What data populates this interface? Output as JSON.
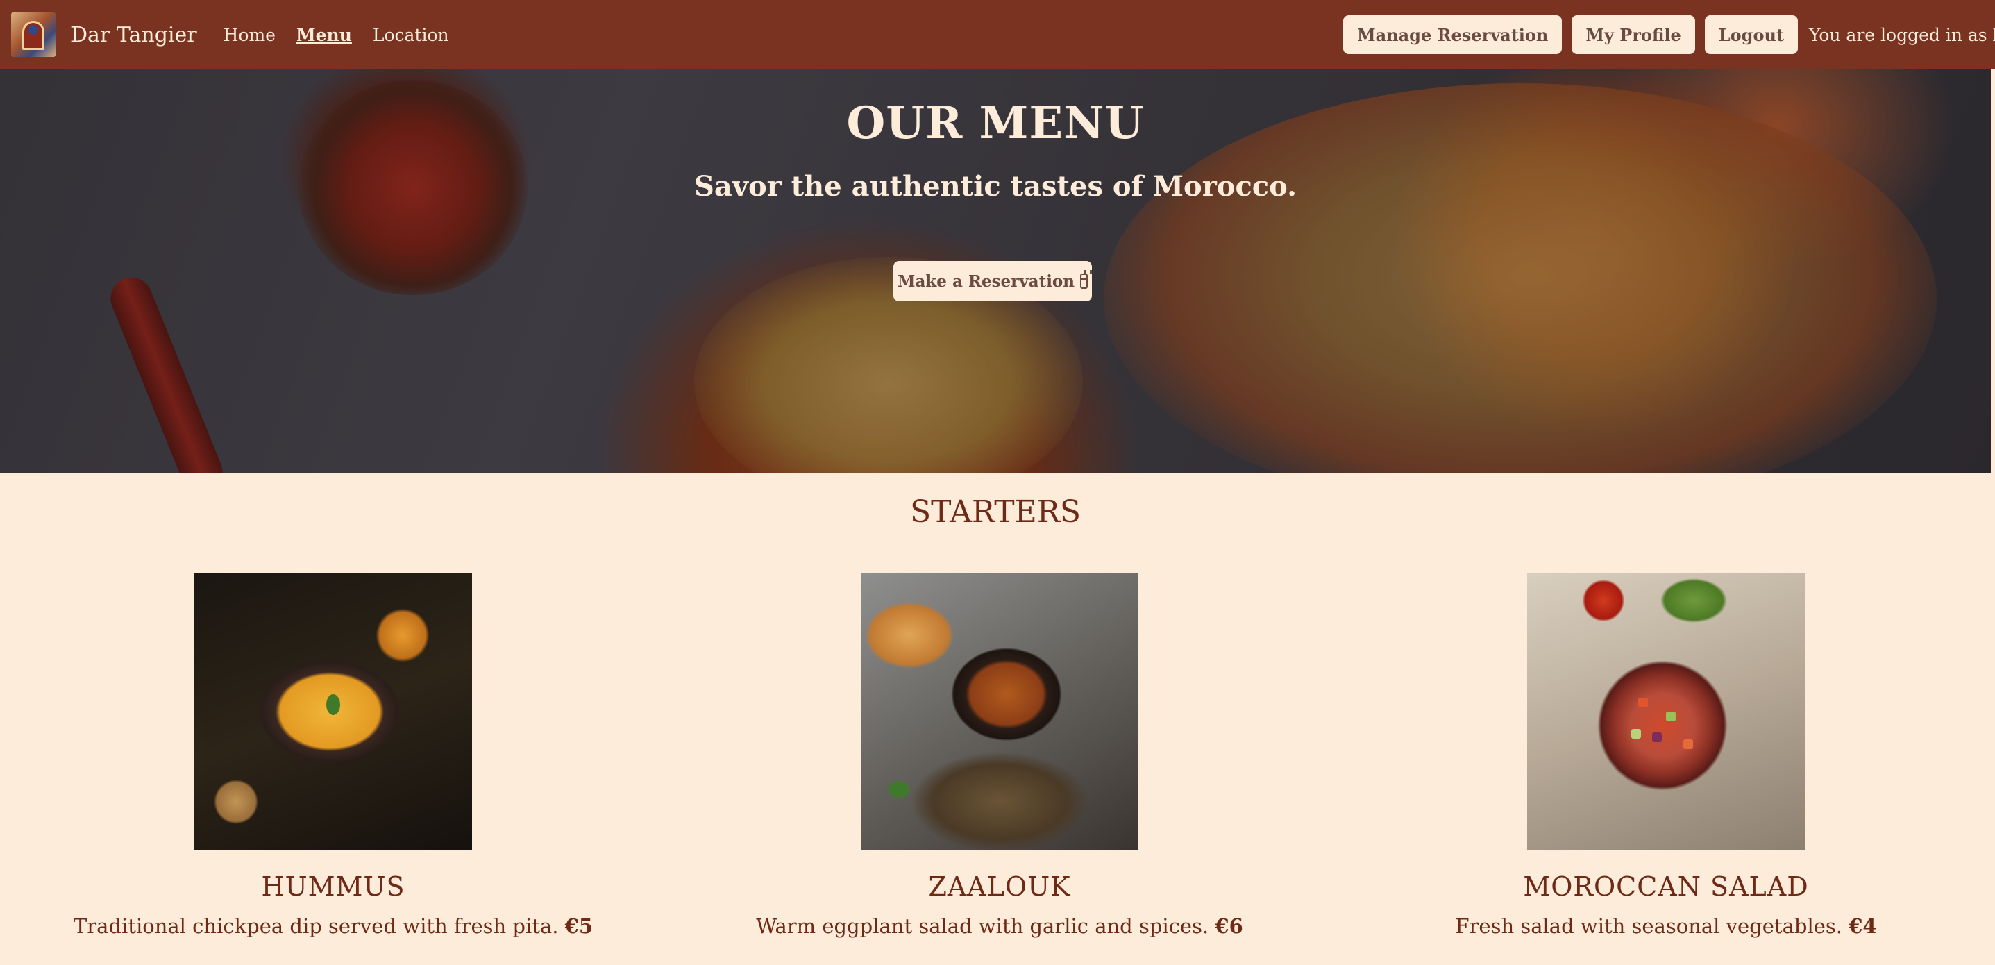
{
  "nav": {
    "brand": "Dar Tangier",
    "links": [
      {
        "label": "Home",
        "active": false
      },
      {
        "label": "Menu",
        "active": true
      },
      {
        "label": "Location",
        "active": false
      }
    ],
    "manage_reservation_label": "Manage Reservation",
    "my_profile_label": "My Profile",
    "logout_label": "Logout",
    "logged_in_prefix": "You are logged in as",
    "username": "bilale"
  },
  "hero": {
    "title": "OUR MENU",
    "subtitle": "Savor the authentic tastes of Morocco.",
    "cta_label": "Make a Reservation",
    "cta_icon": "calendar-icon"
  },
  "menu": {
    "section_title": "STARTERS",
    "dishes": [
      {
        "name": "HUMMUS",
        "description": "Traditional chickpea dip served with fresh pita.",
        "price": "€5"
      },
      {
        "name": "ZAALOUK",
        "description": "Warm eggplant salad with garlic and spices.",
        "price": "€6"
      },
      {
        "name": "MOROCCAN SALAD",
        "description": "Fresh salad with seasonal vegetables.",
        "price": "€4"
      }
    ]
  },
  "colors": {
    "navbar": "#7a3320",
    "background": "#fcecd9",
    "heading_text": "#6e2a16",
    "button_bg": "#fcecd9",
    "button_text": "#6b4a3f"
  }
}
